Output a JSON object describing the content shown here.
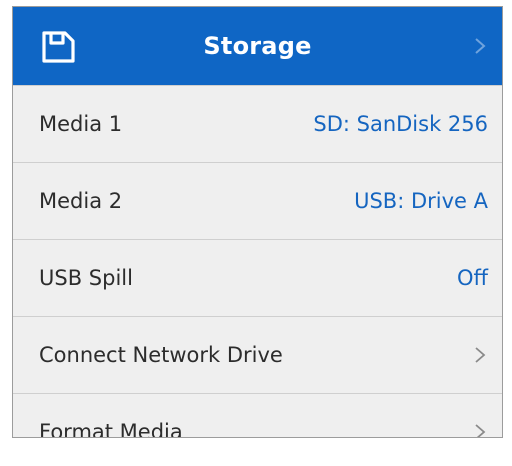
{
  "header": {
    "title": "Storage",
    "icon": "storage-media-icon",
    "chevron_icon": "chevron-right-icon",
    "background_color": "#0f66c5"
  },
  "rows": [
    {
      "label": "Media 1",
      "value": "SD: SanDisk 256"
    },
    {
      "label": "Media 2",
      "value": "USB: Drive A"
    },
    {
      "label": "USB Spill",
      "value": "Off"
    },
    {
      "label": "Connect Network Drive",
      "chevron_icon": "chevron-right-icon"
    },
    {
      "label": "Format Media",
      "chevron_icon": "chevron-right-icon"
    }
  ],
  "colors": {
    "value_text": "#1565c0",
    "label_text": "#2c2c2c",
    "row_background": "#efefef",
    "divider": "#cfcfcf"
  }
}
